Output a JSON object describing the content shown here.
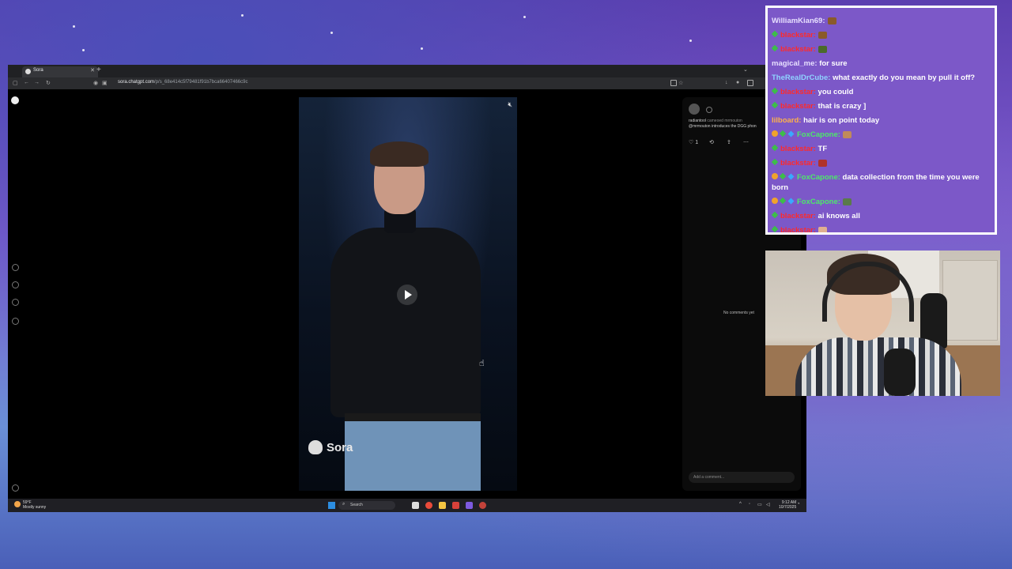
{
  "browser": {
    "tab_title": "Sora",
    "url_domain": "sora.chatgpt.com",
    "url_path": "/p/s_68e414c5f79481f91b7bca66407466c9c"
  },
  "video": {
    "watermark": "Sora"
  },
  "post": {
    "username": "radiantool",
    "cameo_text": "cameoed mrmouton",
    "caption": "@mrmouton introduces the DGG phon",
    "like_count": "1",
    "no_comments": "No comments yet",
    "comment_placeholder": "Add a comment..."
  },
  "taskbar": {
    "weather_temp": "59°F",
    "weather_desc": "Mostly sunny",
    "search_label": "Search",
    "time": "9:12 AM",
    "date": "10/7/2025"
  },
  "chat": {
    "messages": [
      {
        "user": "WilliamKian69:",
        "text": "",
        "user_color": "#e8e0ff",
        "emote": "#8a5a2a"
      },
      {
        "user": "blackstar:",
        "text": "",
        "user_color": "#ff2a2a",
        "sub": true,
        "emote": "#8a5a2a"
      },
      {
        "user": "blackstar:",
        "text": "",
        "user_color": "#ff2a2a",
        "sub": true,
        "emote": "#4a6a2a"
      },
      {
        "user": "magical_me:",
        "text": "for sure",
        "user_color": "#e8e0ff"
      },
      {
        "user": "TheRealDrCube:",
        "text": "what exactly do you mean by pull it off?",
        "user_color": "#8fd3ff"
      },
      {
        "user": "blackstar:",
        "text": "you could",
        "user_color": "#ff2a2a",
        "sub": true
      },
      {
        "user": "blackstar:",
        "text": "that is crazy ]",
        "user_color": "#ff2a2a",
        "sub": true
      },
      {
        "user": "lilboard:",
        "text": "hair is on point today",
        "user_color": "#ffb14a"
      },
      {
        "user": "FoxCapone:",
        "text": "",
        "user_color": "#4de86a",
        "gold": true,
        "sub": true,
        "gem": true,
        "emote": "#c08a5a"
      },
      {
        "user": "blackstar:",
        "text": "TF",
        "user_color": "#ff2a2a",
        "sub": true
      },
      {
        "user": "blackstar:",
        "text": "",
        "user_color": "#ff2a2a",
        "sub": true,
        "emote": "#b0322a"
      },
      {
        "user": "FoxCapone:",
        "text": "data collection from the time you were born",
        "user_color": "#4de86a",
        "gold": true,
        "sub": true,
        "gem": true
      },
      {
        "user": "FoxCapone:",
        "text": "",
        "user_color": "#4de86a",
        "gold": true,
        "sub": true,
        "gem": true,
        "emote": "#5a7a4a"
      },
      {
        "user": "blackstar:",
        "text": "ai knows all",
        "user_color": "#ff2a2a",
        "sub": true
      },
      {
        "user": "blackstar:",
        "text": "",
        "user_color": "#ff2a2a",
        "sub": true,
        "emote": "#e0b090"
      }
    ]
  }
}
